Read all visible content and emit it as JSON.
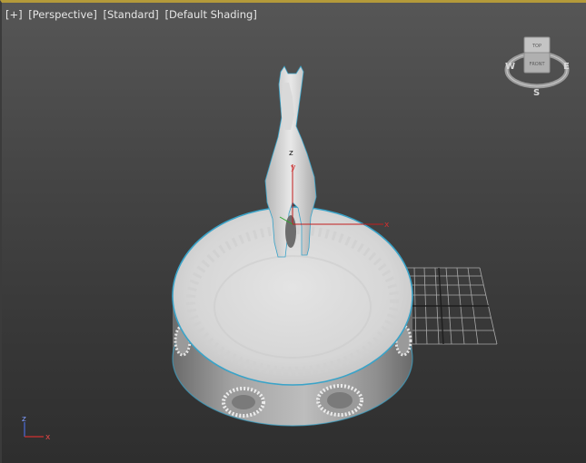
{
  "viewport": {
    "labels": {
      "plus": "[+]",
      "view": "[Perspective]",
      "render_mode": "[Standard]",
      "shading": "[Default Shading]"
    },
    "accent_color": "#b49a3a",
    "selection_color": "#3aa3c8"
  },
  "viewcube": {
    "face_top": "TOP",
    "face_front": "FRONT",
    "compass": {
      "west": "W",
      "east": "E",
      "south": "S"
    }
  },
  "gizmo": {
    "x": "x",
    "y": "y",
    "z": "z"
  },
  "axis_tripod": {
    "x": "x",
    "z": "z"
  },
  "scene": {
    "objects": [
      "horse-model",
      "round-pedestal"
    ],
    "icons": [
      "transform-gizmo-icon",
      "viewcube-icon",
      "axis-tripod-icon",
      "home-grid"
    ]
  }
}
